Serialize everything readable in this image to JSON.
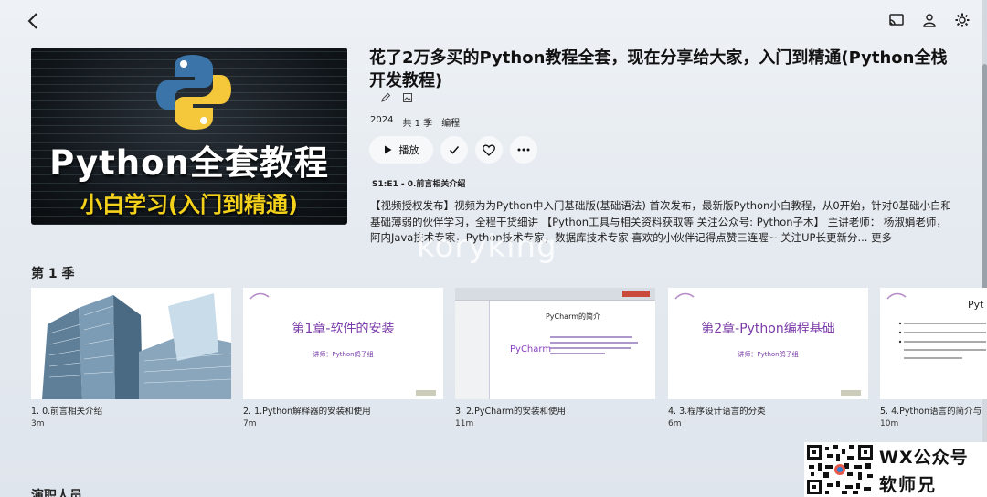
{
  "topbar": {
    "back_icon": "arrow-left-icon",
    "icons": [
      "cast-icon",
      "user-icon",
      "gear-icon"
    ]
  },
  "poster": {
    "title": "Python全套教程",
    "subtitle": "小白学习(入门到精通)",
    "logo": "python-logo"
  },
  "show": {
    "title": "花了2万多买的Python教程全套，现在分享给大家，入门到精通(Python全栈开发教程)",
    "year": "2024",
    "seasons": "共 1 季",
    "genre": "编程"
  },
  "actions": {
    "play_label": "播放"
  },
  "episode_subtitle": "S1:E1 - 0.前言相关介绍",
  "description": "【视频授权发布】视频为为Python中入门基础版(基础语法) 首次发布，最新版Python小白教程，从0开始，针对0基础小白和基础薄弱的伙伴学习，全程干货细讲 【Python工具与相关资料获取等 关注公众号: Python子木】 主讲老师： 杨淑娟老师，阿内Java技术专家，Python技术专家，数据库技术专家 喜欢的小伙伴记得点赞三连喔~ 关注UP长更新分...",
  "more_label": "更多",
  "watermark": "koryking",
  "season_label": "第 1 季",
  "episodes": [
    {
      "name": "1. 0.前言相关介绍",
      "duration": "3m"
    },
    {
      "name": "2. 1.Python解释器的安装和使用",
      "duration": "7m",
      "slide_title": "第1章-软件的安装",
      "slide_sub": "讲师：Python鸽子组"
    },
    {
      "name": "3. 2.PyCharm的安装和使用",
      "duration": "11m",
      "slide_title": "PyCharm的简介",
      "slide_logo": "PyCharm"
    },
    {
      "name": "4. 3.程序设计语言的分类",
      "duration": "6m",
      "slide_title": "第2章-Python编程基础",
      "slide_sub": "讲师：Python鸽子组"
    },
    {
      "name": "5. 4.Python语言的简介与",
      "duration": "10m",
      "slide_title": "Pyt"
    }
  ],
  "cast_label": "演职人员",
  "wx": {
    "line1": "WX公众号",
    "line2": "软师兄"
  },
  "colors": {
    "slide_purple": "#7a3aa8",
    "python_blue": "#3b74a8",
    "python_yellow": "#f5c73b",
    "poster_yellow": "#f4d21c"
  }
}
